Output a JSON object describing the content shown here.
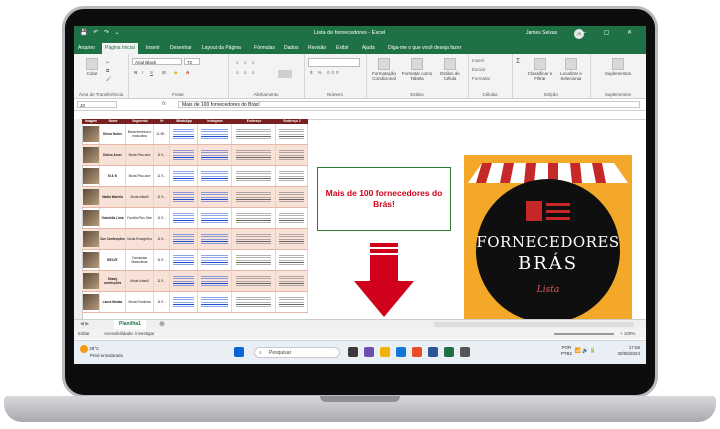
{
  "window": {
    "title": "Lista de fornecedores - Excel",
    "user": "James Seixas",
    "user_initials": "JS",
    "qat": "💾 ↶ ↷ ⌄",
    "controls": "— ▢ ✕"
  },
  "ribbon_tabs": [
    "Arquivo",
    "Página Inicial",
    "Inserir",
    "Desenhar",
    "Layout da Página",
    "Fórmulas",
    "Dados",
    "Revisão",
    "Exibir",
    "Ajuda",
    "Diga-me o que você deseja fazer"
  ],
  "ribbon": {
    "groups": [
      "Área de Transferência",
      "Fonte",
      "Alinhamento",
      "Número",
      "Estilos",
      "Células",
      "Edição",
      "Suplementos"
    ],
    "font_name": "Arial Black",
    "font_size": "72",
    "paste_label": "Colar",
    "buttons": {
      "conditional": "Formatação Condicional",
      "format_table": "Formatar como Tabela",
      "cell_styles": "Estilos de Célula",
      "insert": "Inserir",
      "delete": "Excluir",
      "format": "Formatar",
      "sort": "Classificar e Filtrar",
      "find": "Localizar e Selecionar",
      "addins": "Suplementos"
    }
  },
  "formula_bar": {
    "name_box": "J3",
    "fx": "fx",
    "content": "Mais de 100 fornecedores do Brás!"
  },
  "table": {
    "headers": [
      "Imagem",
      "Nome",
      "Segmento",
      "Nº",
      "WhatsApp",
      "Instagram",
      "Endereço",
      "Endereço 2"
    ],
    "rows": [
      {
        "name": "Dinna Nobre",
        "segment": "Moda feminina e masculina",
        "num": "11 98..."
      },
      {
        "name": "Dinizo Arver",
        "segment": "Moda Plus-size",
        "num": "11 9..."
      },
      {
        "name": "M & N",
        "segment": "Moda Plus-size",
        "num": "11 9..."
      },
      {
        "name": "Nadia Mariela",
        "segment": "Moda infantil",
        "num": "11 9..."
      },
      {
        "name": "Gabriella Lima",
        "segment": "Família Plus Size",
        "num": "11 9..."
      },
      {
        "name": "Zoe Confecções",
        "segment": "Moda Evangélica",
        "num": "11 9..."
      },
      {
        "name": "BELVE",
        "segment": "Camisetas Masculinas",
        "num": "11 9..."
      },
      {
        "name": "Shady confecções",
        "segment": "Moda Infantil",
        "num": "11 9..."
      },
      {
        "name": "Laura Modas",
        "segment": "Moda Feminina",
        "num": "11 9..."
      }
    ]
  },
  "callout": {
    "text": "Mais de 100 fornecedores do Brás!"
  },
  "logo": {
    "line1": "FORNECEDORES",
    "line2": "BRÁS",
    "line3": "Lista"
  },
  "sheet": {
    "tab": "Planilha1",
    "add": "⊕",
    "status_mode": "Editar",
    "accessibility": "Acessibilidade: investigar",
    "zoom": "+ 100%"
  },
  "taskbar": {
    "temp": "28°C",
    "weather": "Pred ensolarado",
    "search_placeholder": "Pesquisar",
    "lang_top": "POR",
    "lang_bottom": "PTB2",
    "time": "17:58",
    "date": "30/06/2024"
  },
  "colors": {
    "excel_green": "#1e7145",
    "header_maroon": "#7a1f1f",
    "callout_red": "#d0021b",
    "logo_orange": "#f3a82a"
  }
}
